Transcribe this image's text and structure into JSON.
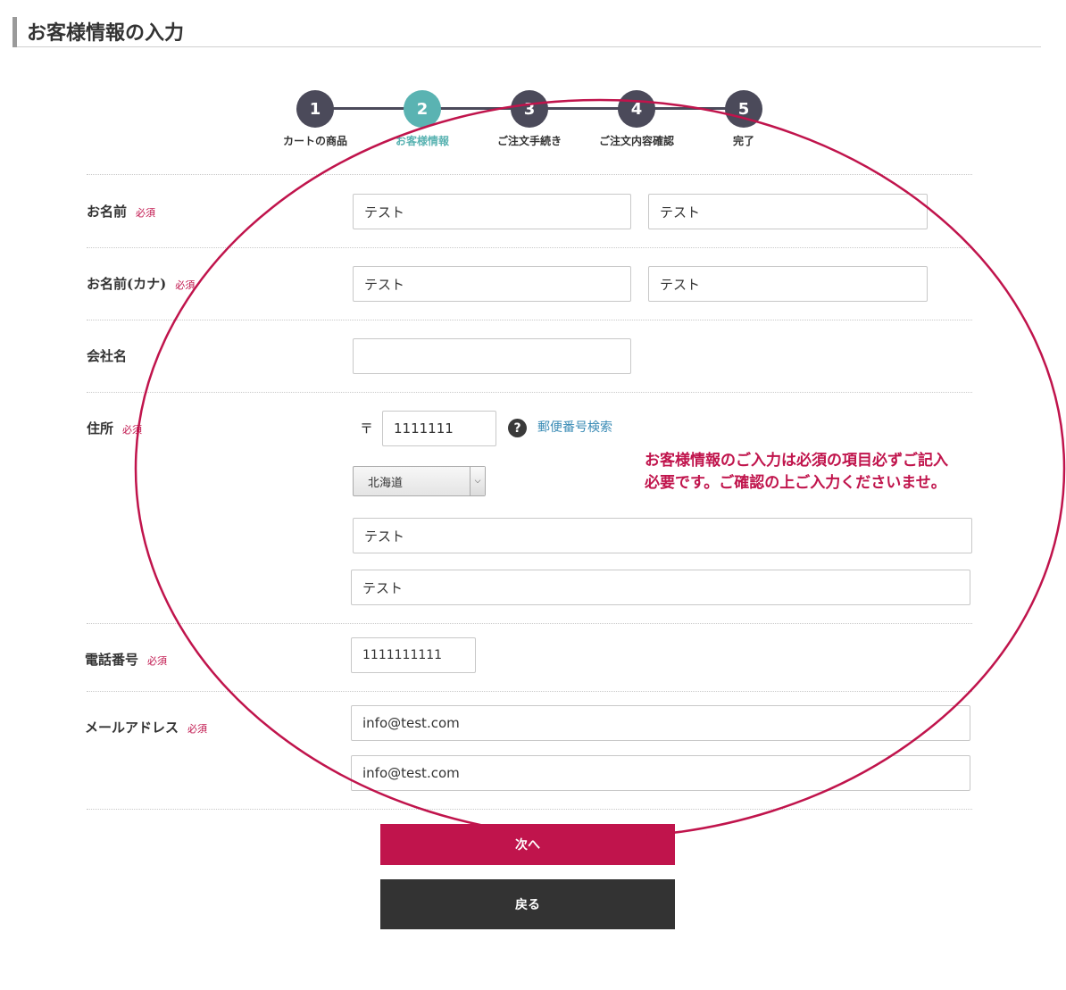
{
  "page_title": "お客様情報の入力",
  "steps": [
    {
      "number": "1",
      "label": "カートの商品",
      "active": false
    },
    {
      "number": "2",
      "label": "お客様情報",
      "active": true
    },
    {
      "number": "3",
      "label": "ご注文手続き",
      "active": false
    },
    {
      "number": "4",
      "label": "ご注文内容確認",
      "active": false
    },
    {
      "number": "5",
      "label": "完了",
      "active": false
    }
  ],
  "required_label": "必須",
  "form": {
    "name": {
      "label": "お名前",
      "last": "テスト",
      "first": "テスト"
    },
    "name_kana": {
      "label": "お名前(カナ)",
      "last": "テスト",
      "first": "テスト"
    },
    "company": {
      "label": "会社名",
      "value": ""
    },
    "address": {
      "label": "住所",
      "zip_mark": "〒",
      "zip": "1111111",
      "help_icon": "?",
      "zip_search": "郵便番号検索",
      "prefecture": "北海道",
      "line1": "テスト",
      "line2": "テスト"
    },
    "phone": {
      "label": "電話番号",
      "value": "1111111111"
    },
    "email": {
      "label": "メールアドレス",
      "value": "info@test.com",
      "confirm": "info@test.com"
    }
  },
  "annotation": {
    "line1": "お客様情報のご入力は必須の項目必ずご記入",
    "line2": "必要です。ご確認の上ご入力くださいませ。",
    "color": "#c0144c"
  },
  "buttons": {
    "next": "次へ",
    "back": "戻る"
  },
  "colors": {
    "accent": "#c0144c",
    "step_active": "#5ab3b2",
    "step_inactive": "#4b4a5a",
    "link": "#3a8bb5"
  }
}
